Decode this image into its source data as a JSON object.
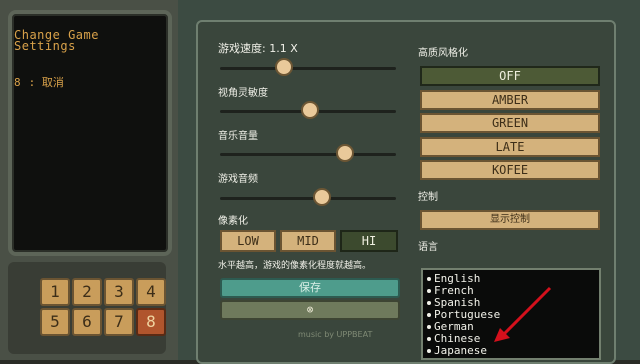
{
  "left_panel": {
    "title": "Change Game\nSettings",
    "key_number": "8",
    "cancel_label": ": 取消"
  },
  "keypad": {
    "keys": [
      "1",
      "2",
      "3",
      "4",
      "5",
      "6",
      "7",
      "8"
    ],
    "active": "8"
  },
  "settings": {
    "game_speed_label": "游戏速度: 1.1 X",
    "view_sensitivity_label": "视角灵敏度",
    "music_volume_label": "音乐音量",
    "sound_volume_label": "游戏音频",
    "pixelation_label": "像素化",
    "pixelation_options": [
      "LOW",
      "MID",
      "HI"
    ],
    "pixelation_selected": "HI",
    "pixelation_note": "水平越高，游戏的像素化程度就越高。",
    "save_label": "保存",
    "cancel_symbol": "⊗"
  },
  "slider_levels": {
    "game_speed": 0.35,
    "view_sensitivity": 0.5,
    "music_volume": 0.7,
    "sound_volume": 0.57
  },
  "theme": {
    "label": "高质风格化",
    "options": [
      "OFF",
      "AMBER",
      "GREEN",
      "LATE",
      "KOFEE"
    ],
    "selected": "OFF"
  },
  "controls": {
    "label": "控制",
    "show_controls_label": "显示控制"
  },
  "language": {
    "label": "语言",
    "options": [
      "English",
      "French",
      "Spanish",
      "Portuguese",
      "German",
      "Chinese",
      "Japanese"
    ]
  },
  "watermark": "music by UPPBEAT",
  "colors": {
    "accent_gold": "#d9a24a",
    "button_tan": "#d4b27c",
    "active_green": "#4d5a36",
    "save_teal": "#4e9c8c",
    "arrow_red": "#d4101c"
  }
}
